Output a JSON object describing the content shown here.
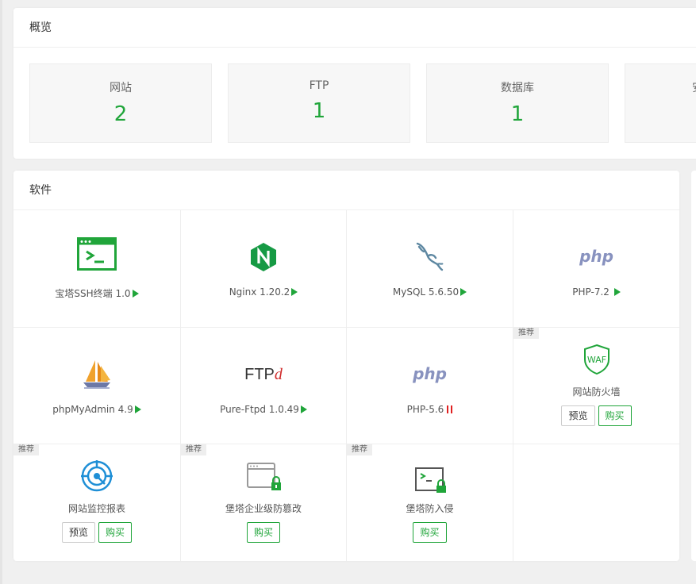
{
  "overview": {
    "title": "概览",
    "cards": [
      {
        "label": "网站",
        "value": "2"
      },
      {
        "label": "FTP",
        "value": "1"
      },
      {
        "label": "数据库",
        "value": "1"
      },
      {
        "label": "安",
        "value": ""
      }
    ]
  },
  "software": {
    "title": "软件",
    "badge": "推荐",
    "preview_label": "预览",
    "buy_label": "购买",
    "items": [
      {
        "name": "宝塔SSH终端 1.0",
        "status": "running",
        "icon": "terminal-icon"
      },
      {
        "name": "Nginx 1.20.2",
        "status": "running",
        "icon": "nginx-icon"
      },
      {
        "name": "MySQL 5.6.50",
        "status": "running",
        "icon": "mysql-dolphin-icon"
      },
      {
        "name": "PHP-7.2",
        "status": "running",
        "icon": "php-icon",
        "icon_text": "php"
      },
      {
        "name": "phpMyAdmin 4.9",
        "status": "running",
        "icon": "sailboat-icon"
      },
      {
        "name": "Pure-Ftpd 1.0.49",
        "status": "running",
        "icon": "ftpd-icon",
        "icon_text": "FTP",
        "icon_text2": "d"
      },
      {
        "name": "PHP-5.6",
        "status": "stopped",
        "icon": "php-icon",
        "icon_text": "php"
      },
      {
        "name": "网站防火墙",
        "status": "recommended",
        "icon": "waf-shield-icon",
        "icon_text": "WAF"
      },
      {
        "name": "网站监控报表",
        "status": "recommended",
        "icon": "radar-icon"
      },
      {
        "name": "堡塔企业级防篡改",
        "status": "recommended",
        "icon": "window-lock-icon"
      },
      {
        "name": "堡塔防入侵",
        "status": "recommended",
        "icon": "terminal-lock-icon"
      }
    ]
  },
  "colors": {
    "accent": "#20a53a",
    "stopped": "#e02020",
    "php": "#8892bf"
  }
}
